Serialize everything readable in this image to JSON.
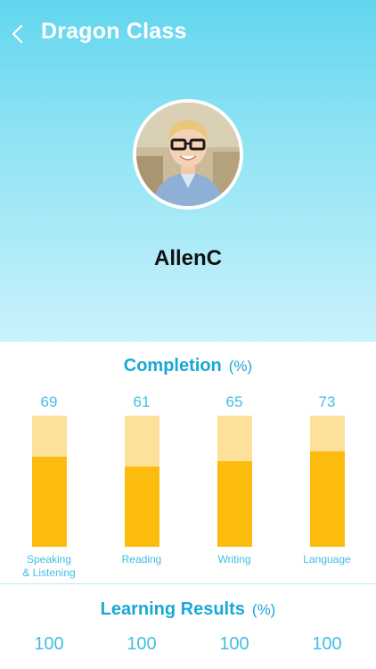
{
  "header": {
    "title": "Dragon Class",
    "back_icon": "chevron-left-icon"
  },
  "student": {
    "name": "AllenC",
    "avatar": "student-photo"
  },
  "completion": {
    "title": "Completion",
    "unit": "(%)"
  },
  "learning_results": {
    "title": "Learning Results",
    "unit": "(%)",
    "values": [
      "100",
      "100",
      "100",
      "100"
    ]
  },
  "colors": {
    "header_gradient_top": "#62d6ee",
    "header_gradient_bottom": "#c9f2fb",
    "accent_text": "#1aa7d8",
    "bar_fill": "#fbbc0e",
    "bar_track": "#fde19a"
  },
  "chart_data": {
    "type": "bar",
    "categories": [
      "Speaking & Listening",
      "Reading",
      "Writing",
      "Language"
    ],
    "values": [
      69,
      61,
      65,
      73
    ],
    "title": "Completion",
    "ylabel": "(%)",
    "ylim": [
      0,
      100
    ]
  }
}
